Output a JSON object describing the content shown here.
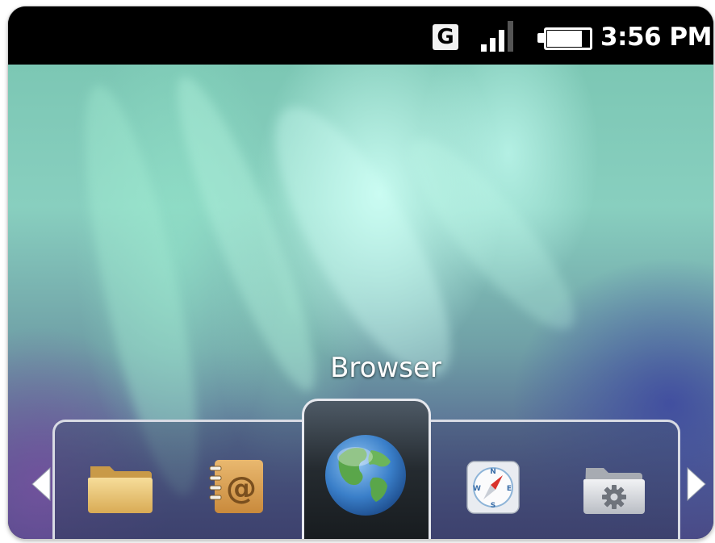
{
  "status_bar": {
    "network_type": "G",
    "signal_level": 0.75,
    "battery_level": 0.85,
    "time": "3:56 PM"
  },
  "launcher": {
    "selected_app_label": "Browser",
    "dock_icons": [
      {
        "name": "folder-icon"
      },
      {
        "name": "contacts-icon"
      },
      {
        "name": "browser-globe-icon"
      },
      {
        "name": "compass-icon"
      },
      {
        "name": "settings-folder-icon"
      }
    ]
  },
  "colors": {
    "status_bar_bg": "#000000",
    "label_text": "#ffffff",
    "dock_border": "#d8dbe4"
  }
}
